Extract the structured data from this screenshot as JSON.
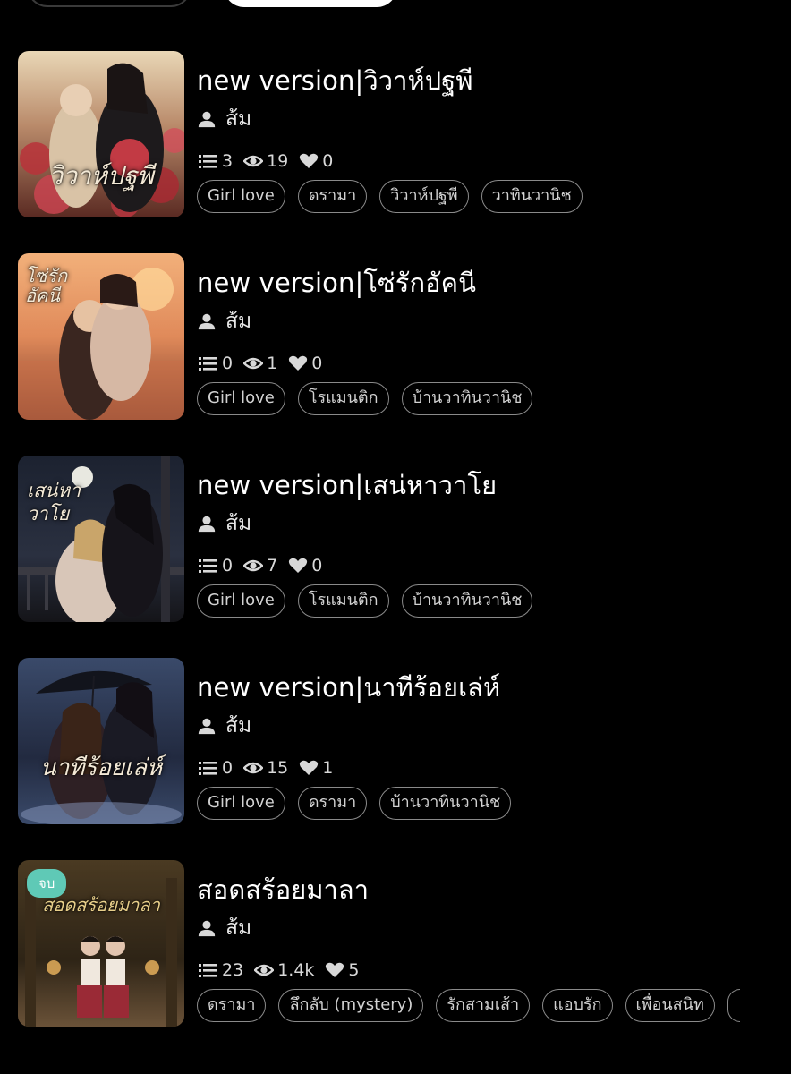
{
  "stories": [
    {
      "title": "new version|วิวาห์ปฐพี",
      "cover_title": "วิวาห์ปฐพี",
      "author": "ส้ม",
      "chapters": "3",
      "views": "19",
      "likes": "0",
      "tags": [
        "Girl love",
        "ดรามา",
        "วิวาห์ปฐพี",
        "วาทินวานิช"
      ],
      "badge": ""
    },
    {
      "title": "new version|โซ่รักอัคนี",
      "cover_title": "โซ่รัก อัคนี",
      "author": "ส้ม",
      "chapters": "0",
      "views": "1",
      "likes": "0",
      "tags": [
        "Girl love",
        "โรแมนติก",
        "บ้านวาทินวานิช"
      ],
      "badge": ""
    },
    {
      "title": "new version|เสน่หาวาโย",
      "cover_title": "เสน่หา วาโย",
      "author": "ส้ม",
      "chapters": "0",
      "views": "7",
      "likes": "0",
      "tags": [
        "Girl love",
        "โรแมนติก",
        "บ้านวาทินวานิช"
      ],
      "badge": ""
    },
    {
      "title": "new version|นาทีร้อยเล่ห์",
      "cover_title": "นาทีร้อยเล่ห์",
      "author": "ส้ม",
      "chapters": "0",
      "views": "15",
      "likes": "1",
      "tags": [
        "Girl love",
        "ดรามา",
        "บ้านวาทินวานิช"
      ],
      "badge": ""
    },
    {
      "title": "สอดสร้อยมาลา",
      "cover_title": "สอดสร้อยมาลา",
      "author": "ส้ม",
      "chapters": "23",
      "views": "1.4k",
      "likes": "5",
      "tags": [
        "ดรามา",
        "ลึกลับ (mystery)",
        "รักสามเส้า",
        "แอบรัก",
        "เพื่อนสนิท"
      ],
      "badge": "จบ"
    }
  ],
  "icons": {
    "author": "person-icon",
    "chapters": "list-icon",
    "views": "eye-icon",
    "likes": "heart-icon"
  },
  "colors": {
    "background": "#000000",
    "badge": "#5fc9b6",
    "tag_border": "#8a8a8a"
  }
}
